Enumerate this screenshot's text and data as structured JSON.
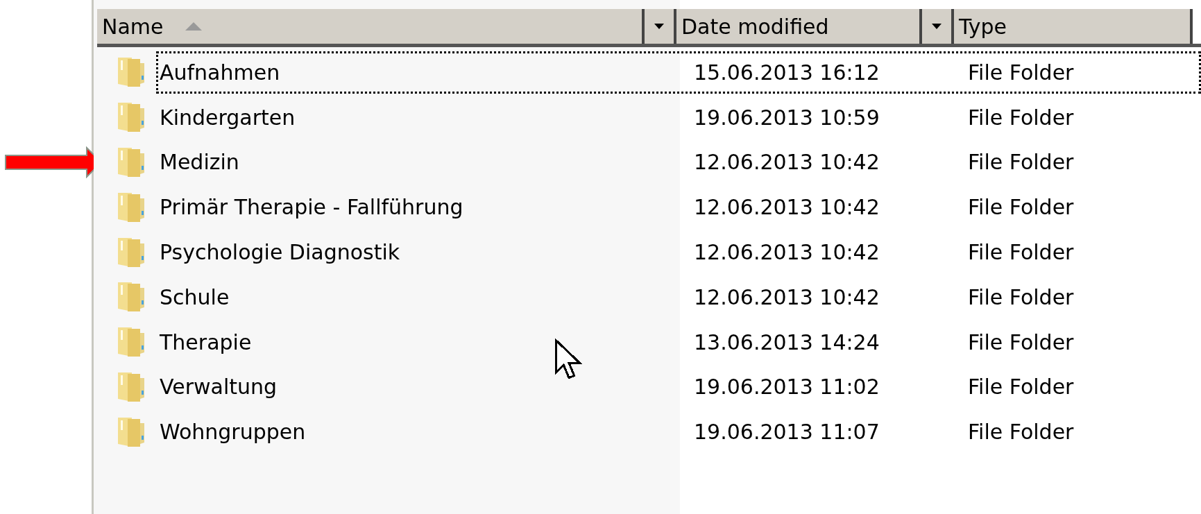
{
  "columns": [
    {
      "label": "Name",
      "sorted": true,
      "has_menu": true
    },
    {
      "label": "Date modified",
      "sorted": false,
      "has_menu": true
    },
    {
      "label": "Type",
      "sorted": false,
      "has_menu": false
    }
  ],
  "rows": [
    {
      "name": "Aufnahmen",
      "date": "15.06.2013 16:12",
      "type": "File Folder",
      "focused": true,
      "marked": false
    },
    {
      "name": "Kindergarten",
      "date": "19.06.2013 10:59",
      "type": "File Folder",
      "focused": false,
      "marked": false
    },
    {
      "name": "Medizin",
      "date": "12.06.2013 10:42",
      "type": "File Folder",
      "focused": false,
      "marked": true
    },
    {
      "name": "Primär Therapie - Fallführung",
      "date": "12.06.2013 10:42",
      "type": "File Folder",
      "focused": false,
      "marked": false
    },
    {
      "name": "Psychologie Diagnostik",
      "date": "12.06.2013 10:42",
      "type": "File Folder",
      "focused": false,
      "marked": false
    },
    {
      "name": "Schule",
      "date": "12.06.2013 10:42",
      "type": "File Folder",
      "focused": false,
      "marked": false
    },
    {
      "name": "Therapie",
      "date": "13.06.2013 14:24",
      "type": "File Folder",
      "focused": false,
      "marked": false
    },
    {
      "name": "Verwaltung",
      "date": "19.06.2013 11:02",
      "type": "File Folder",
      "focused": false,
      "marked": false
    },
    {
      "name": "Wohngruppen",
      "date": "19.06.2013 11:07",
      "type": "File Folder",
      "focused": false,
      "marked": false
    }
  ]
}
